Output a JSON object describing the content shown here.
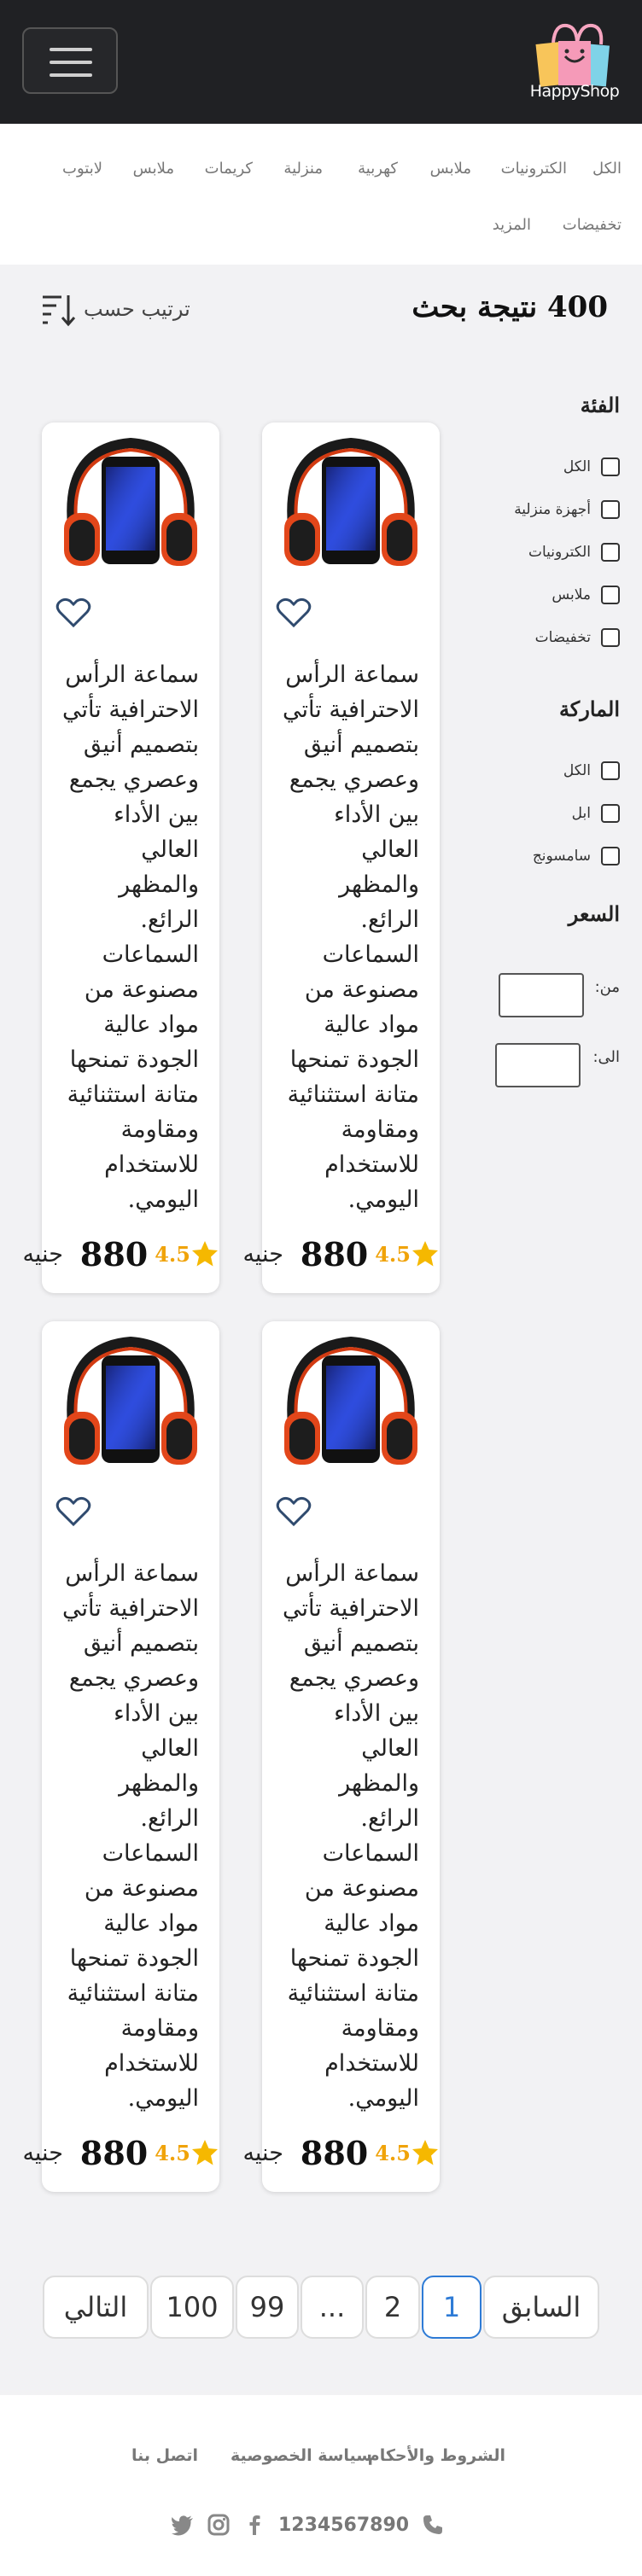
{
  "header": {
    "menu_icon": "hamburger-menu-icon",
    "logo_text": "HappyShop",
    "logo_icon": "shopping-bag-icon"
  },
  "nav": {
    "items": [
      "الكل",
      "الكترونيات",
      "ملابس",
      "كهربية",
      "منزلية",
      "كريمات",
      "ملابس",
      "لابتوب",
      "تخفيضات",
      "المزيد"
    ]
  },
  "results": {
    "title": "400 نتيجة بحث",
    "sort_label": "ترتيب حسب",
    "sort_icon": "sort-icon"
  },
  "filters": {
    "category": {
      "heading": "الفئة",
      "options": [
        "الكل",
        "أجهزة منزلية",
        "الكترونيات",
        "ملابس",
        "تخفيضات"
      ]
    },
    "brand": {
      "heading": "الماركة",
      "options": [
        "الكل",
        "ابل",
        "سامسونج"
      ]
    },
    "price": {
      "heading": "السعر",
      "from_label": "من:",
      "to_label": "الى:",
      "from_value": "",
      "to_value": ""
    }
  },
  "products": [
    {
      "description": "سماعة الرأس الاحترافية تأتي بتصميم أنيق وعصري يجمع بين الأداء العالي والمظهر الرائع. السماعات مصنوعة من مواد عالية الجودة تمنحها متانة استثنائية ومقاومة للاستخدام اليومي.",
      "rating": "4.5",
      "price": "880",
      "currency": "جنيه"
    },
    {
      "description": "سماعة الرأس الاحترافية تأتي بتصميم أنيق وعصري يجمع بين الأداء العالي والمظهر الرائع. السماعات مصنوعة من مواد عالية الجودة تمنحها متانة استثنائية ومقاومة للاستخدام اليومي.",
      "rating": "4.5",
      "price": "880",
      "currency": "جنيه"
    },
    {
      "description": "سماعة الرأس الاحترافية تأتي بتصميم أنيق وعصري يجمع بين الأداء العالي والمظهر الرائع. السماعات مصنوعة من مواد عالية الجودة تمنحها متانة استثنائية ومقاومة للاستخدام اليومي.",
      "rating": "4.5",
      "price": "880",
      "currency": "جنيه"
    },
    {
      "description": "سماعة الرأس الاحترافية تأتي بتصميم أنيق وعصري يجمع بين الأداء العالي والمظهر الرائع. السماعات مصنوعة من مواد عالية الجودة تمنحها متانة استثنائية ومقاومة للاستخدام اليومي.",
      "rating": "4.5",
      "price": "880",
      "currency": "جنيه"
    }
  ],
  "pagination": {
    "prev_label": "السابق",
    "next_label": "التالي",
    "pages": [
      "1",
      "2",
      "...",
      "99",
      "100"
    ],
    "current": "1"
  },
  "footer": {
    "links": [
      "الشروط والأحكام",
      "سياسة الخصوصية",
      "اتصل بنا"
    ],
    "phone": "1234567890",
    "social_icons": [
      "facebook-icon",
      "instagram-icon",
      "twitter-icon"
    ]
  },
  "colors": {
    "header_bg": "#202124",
    "star": "#f5b800",
    "rating_text": "#f0a30a",
    "pager_active": "#2e7bd6",
    "heart_outline": "#2f4a6e"
  }
}
